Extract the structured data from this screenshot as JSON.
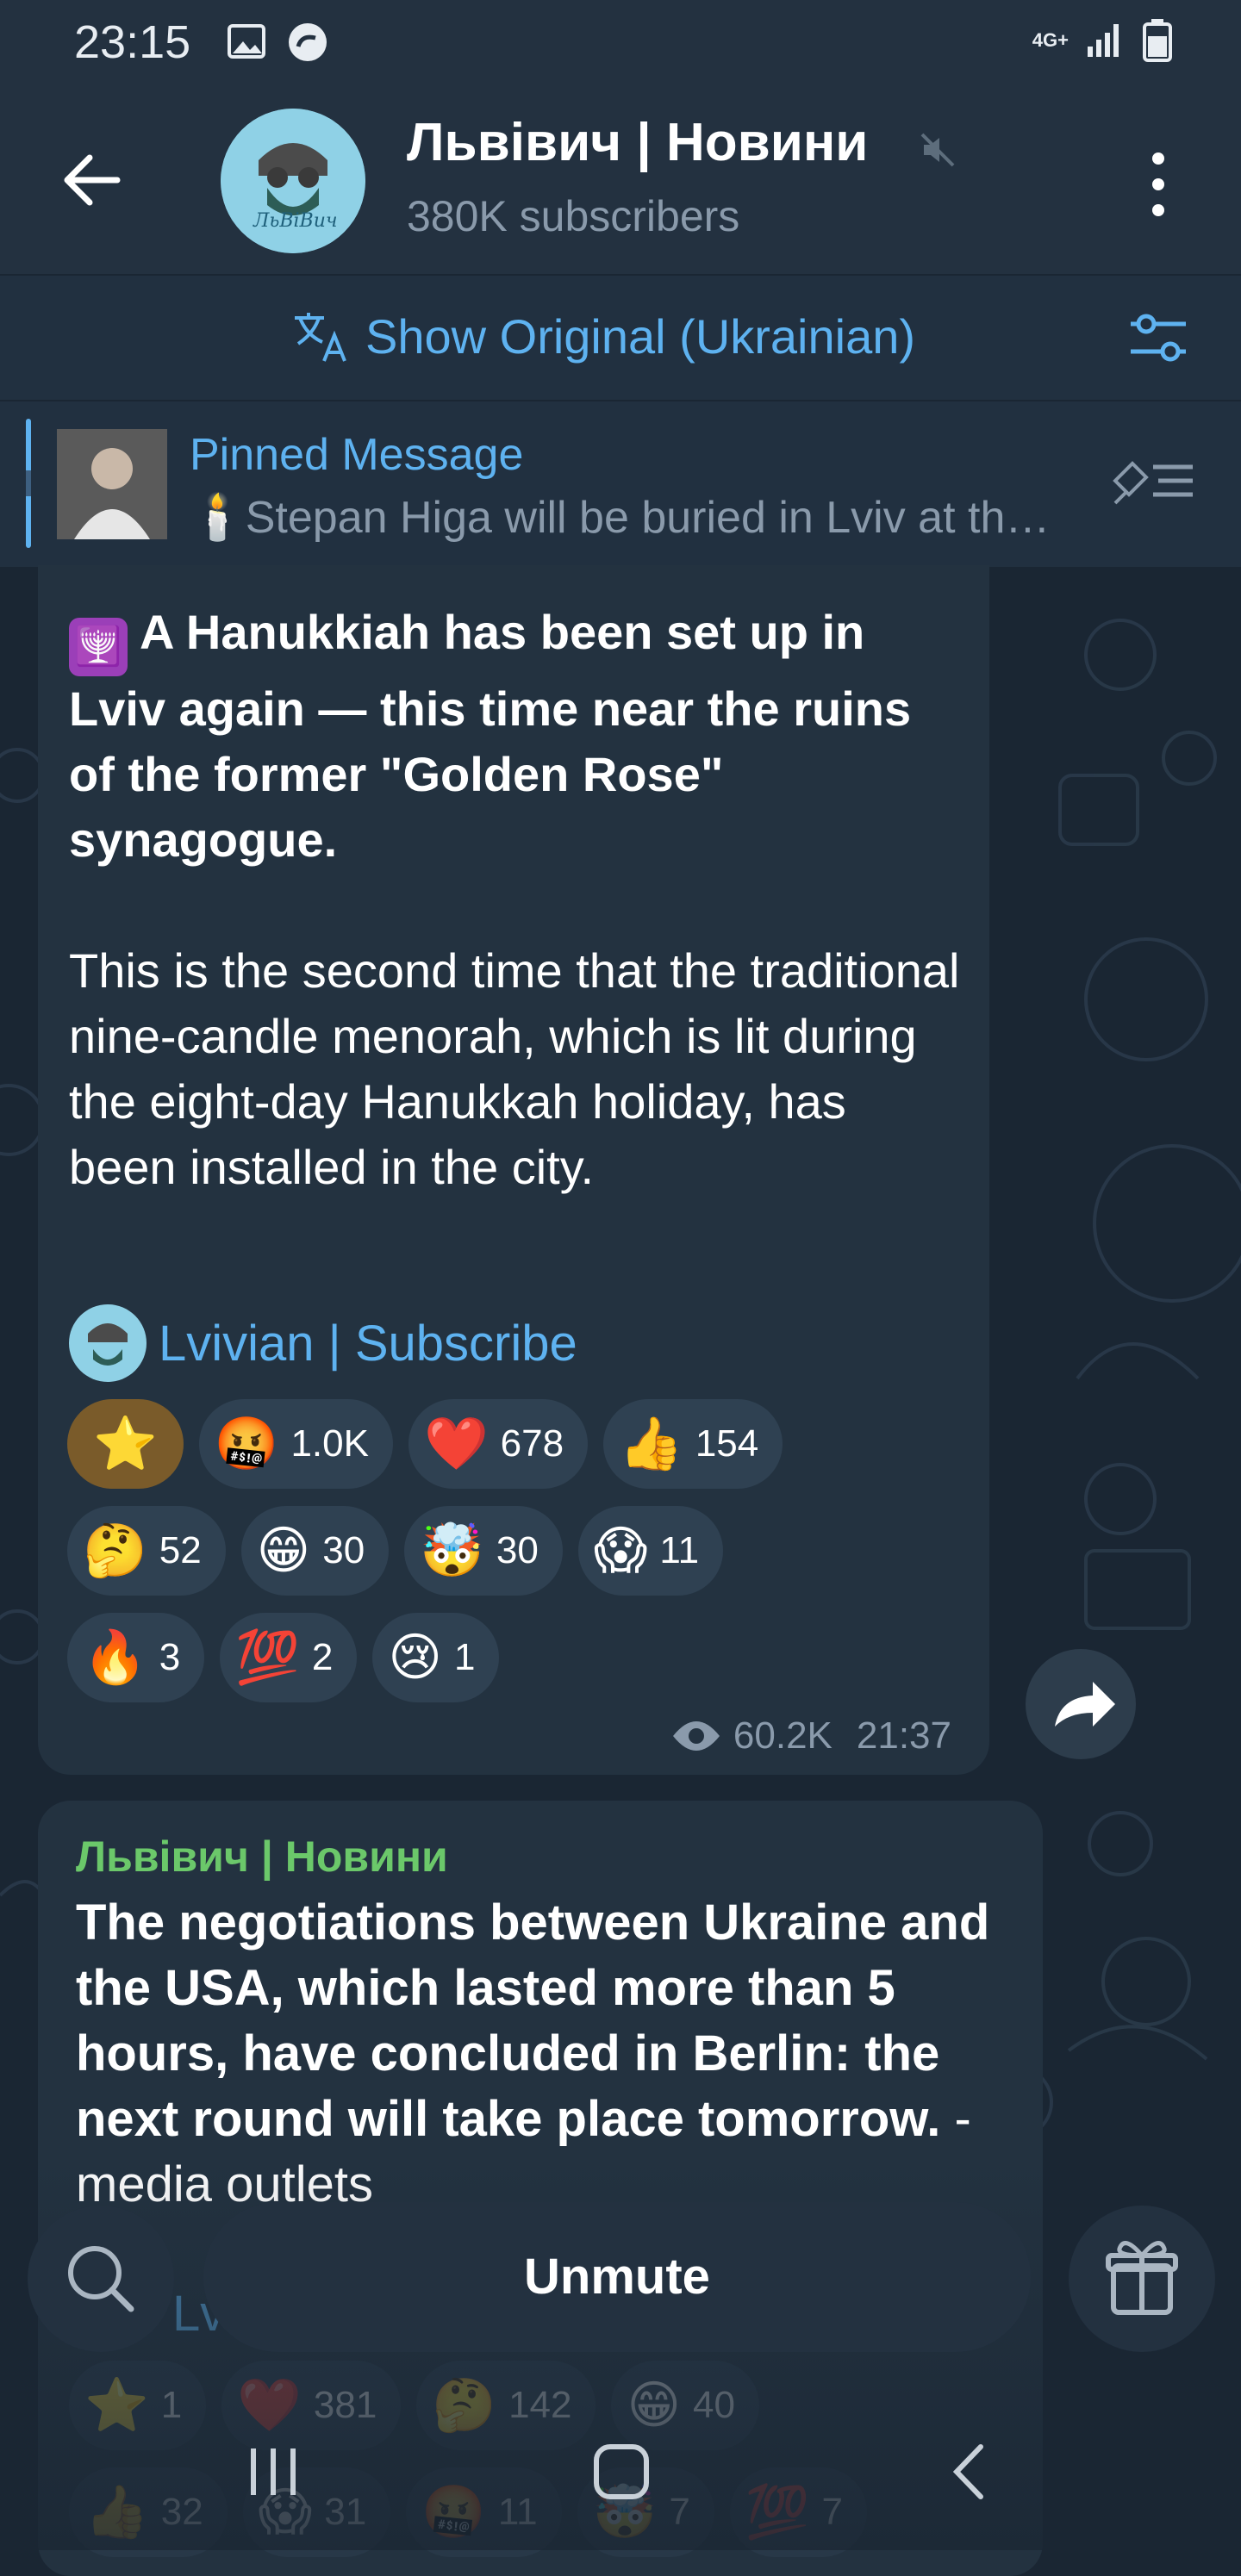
{
  "status_bar": {
    "time": "23:15",
    "network": "4G+"
  },
  "header": {
    "channel_title": "Львівич | Новини",
    "subscribers": "380K subscribers",
    "avatar_text": "ЛьВіВич"
  },
  "translate_bar": {
    "label": "Show Original (Ukrainian)"
  },
  "pinned": {
    "title": "Pinned Message",
    "text": "🕯️Stepan Higa will be buried in Lviv at th…"
  },
  "message1": {
    "emoji": "🕎",
    "headline": "A Hanukkiah has been set up in Lviv again — this time near the ruins of the former \"Golden Rose\" synagogue.",
    "body": "This is the second time that the traditional nine-candle menorah, which is lit during the eight-day Hanukkah holiday, has been installed in the city.",
    "subscribe_link": "Lvivian | Subscribe",
    "reactions": [
      [
        {
          "emoji": "⭐",
          "count": ""
        },
        {
          "emoji": "🤬",
          "count": "1.0K"
        },
        {
          "emoji": "❤️",
          "count": "678"
        },
        {
          "emoji": "👍",
          "count": "154"
        }
      ],
      [
        {
          "emoji": "🤔",
          "count": "52"
        },
        {
          "emoji": "😁",
          "count": "30"
        },
        {
          "emoji": "🤯",
          "count": "30"
        },
        {
          "emoji": "😱",
          "count": "11"
        }
      ],
      [
        {
          "emoji": "🔥",
          "count": "3"
        },
        {
          "emoji": "💯",
          "count": "2"
        },
        {
          "emoji": "😢",
          "count": "1"
        }
      ]
    ],
    "views": "60.2K",
    "time": "21:37"
  },
  "message2": {
    "author": "Львівич | Новини",
    "text_bold": "The negotiations between Ukraine and the USA, which lasted more than 5 hours, have concluded in Berlin: the next round will take place tomorrow.",
    "text_regular": " - media outlets",
    "subscribe_partial": "Lv",
    "reactions": [
      [
        {
          "emoji": "⭐",
          "count": "1"
        },
        {
          "emoji": "❤️",
          "count": "381"
        },
        {
          "emoji": "🤔",
          "count": "142"
        },
        {
          "emoji": "😁",
          "count": "40"
        }
      ],
      [
        {
          "emoji": "👍",
          "count": "32"
        },
        {
          "emoji": "😱",
          "count": "31"
        },
        {
          "emoji": "🤬",
          "count": "11"
        },
        {
          "emoji": "🤯",
          "count": "7"
        },
        {
          "emoji": "💯",
          "count": "7"
        }
      ]
    ]
  },
  "bottom_bar": {
    "unmute_label": "Unmute"
  },
  "colors": {
    "background": "#1a2633",
    "header": "#233140",
    "bubble": "#233240",
    "accent_blue": "#5eb2f0",
    "author_green": "#6bc86a",
    "chip": "#2f4152",
    "muted_text": "#8a9aab"
  }
}
